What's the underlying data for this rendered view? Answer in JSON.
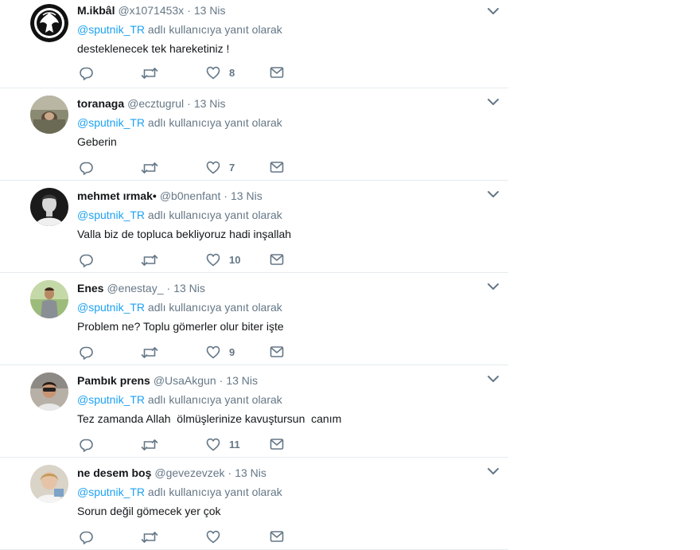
{
  "reply_prefix": "adlı kullanıcıya yanıt olarak",
  "mention": "@sputnik_TR",
  "tweets": [
    {
      "name": "M.ikbâl",
      "handle": "@x1071453x",
      "sep": "·",
      "time": "13 Nis",
      "text": "desteklenecek tek hareketiniz !",
      "likes": "8"
    },
    {
      "name": "toranaga",
      "handle": "@ecztugrul",
      "sep": "·",
      "time": "13 Nis",
      "text": "Geberin",
      "likes": "7"
    },
    {
      "name": "mehmet ırmak•",
      "handle": "@b0nenfant",
      "sep": "·",
      "time": "13 Nis",
      "text": "Valla biz de topluca bekliyoruz hadi inşallah",
      "likes": "10"
    },
    {
      "name": "Enes",
      "handle": "@enestay_",
      "sep": "·",
      "time": "13 Nis",
      "text": "Problem ne? Toplu gömerler olur biter işte",
      "likes": "9"
    },
    {
      "name": "Pambık prens",
      "handle": "@UsaAkgun",
      "sep": "·",
      "time": "13 Nis",
      "text": "Tez zamanda Allah  ölmüşlerinize kavuştursun  canım",
      "likes": "11"
    },
    {
      "name": "ne desem boş",
      "handle": "@gevezevzek",
      "sep": "·",
      "time": "13 Nis",
      "text": "Sorun değil gömecek yer çok",
      "likes": ""
    }
  ],
  "icons": {
    "reply": "reply-icon",
    "retweet": "retweet-icon",
    "like": "heart-icon",
    "message": "envelope-icon",
    "more": "chevron-down-icon"
  },
  "colors": {
    "mention": "#1da1f2",
    "secondary_text": "#657786",
    "primary_text": "#14171a",
    "divider": "#e6ecf0"
  }
}
